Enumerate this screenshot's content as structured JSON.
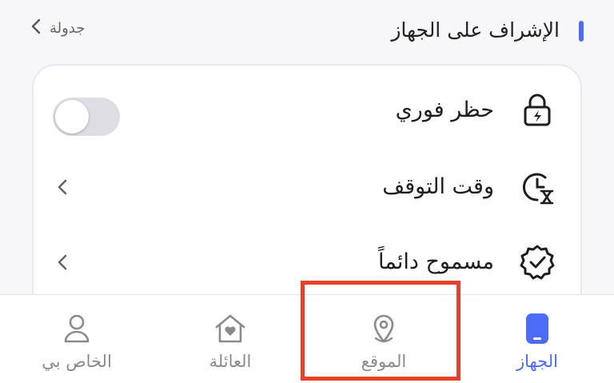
{
  "colors": {
    "accent": "#4a6cf7",
    "inactive": "#8a8a90",
    "highlight": "#e8412b"
  },
  "header": {
    "title": "الإشراف على الجهاز",
    "link_label": "جدولة"
  },
  "rows": [
    {
      "label": "حظر فوري",
      "icon": "lock-bolt-icon",
      "control": "toggle",
      "toggle_on": false
    },
    {
      "label": "وقت التوقف",
      "icon": "clock-hourglass-icon",
      "control": "chevron"
    },
    {
      "label": "مسموح دائماً",
      "icon": "badge-check-icon",
      "control": "chevron"
    }
  ],
  "nav": {
    "tabs": [
      {
        "label": "الجهاز",
        "icon": "phone-icon",
        "active": true
      },
      {
        "label": "الموقع",
        "icon": "location-pin-icon",
        "active": false
      },
      {
        "label": "العائلة",
        "icon": "home-heart-icon",
        "active": false
      },
      {
        "label": "الخاص بي",
        "icon": "user-icon",
        "active": false
      }
    ]
  }
}
